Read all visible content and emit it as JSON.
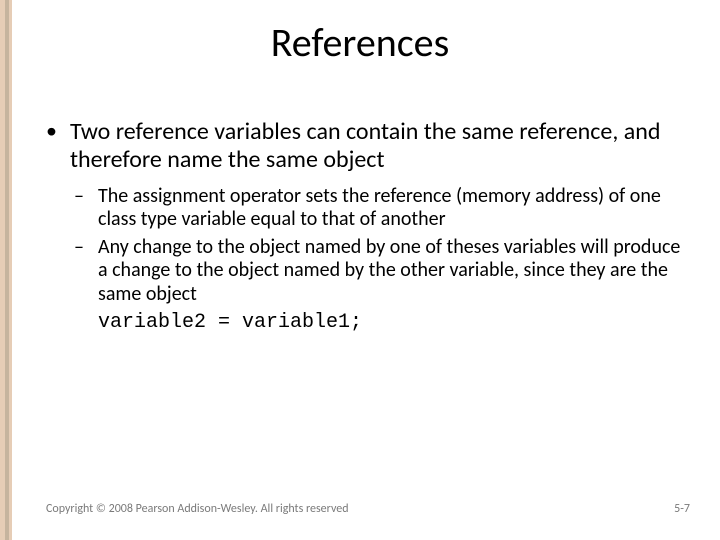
{
  "title": "References",
  "bullets": {
    "lvl1_0": "Two reference variables can contain  the same reference, and therefore name the same object",
    "lvl2_0": "The assignment operator sets the reference (memory address) of one class type variable equal to that of another",
    "lvl2_1": "Any change to the object named by one of theses variables will produce a change to the object named by the other variable, since they are the same object"
  },
  "code": "variable2 = variable1;",
  "footer": {
    "copyright": "Copyright © 2008 Pearson Addison-Wesley. All rights reserved",
    "page": "5-7"
  }
}
